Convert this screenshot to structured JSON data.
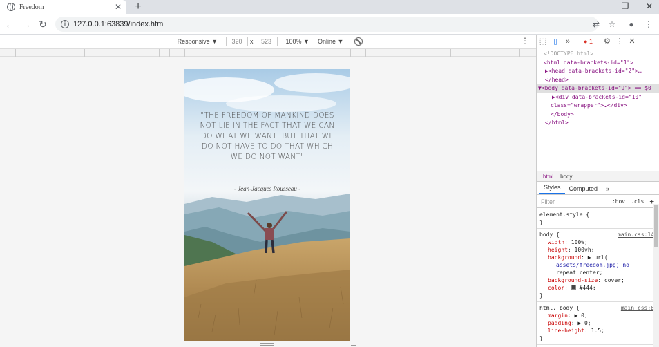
{
  "browser": {
    "tab_title": "Freedom",
    "tab_close": "✕",
    "new_tab": "+",
    "url": "127.0.0.1:63839/index.html"
  },
  "device_toolbar": {
    "mode": "Responsive ▼",
    "width": "320",
    "x_sep": "x",
    "height": "523",
    "zoom": "100% ▼",
    "network": "Online ▼",
    "more": "⋮"
  },
  "page": {
    "quote": "\"The freedom of mankind does not lie in the fact that we can do what we want, but that we do not have to do that which we do not want\"",
    "author": "- Jean-Jacques Rousseau -"
  },
  "devtools": {
    "top": {
      "more_tabs": "»",
      "errors": "1",
      "settings": "⚙",
      "menu": "⋮",
      "close": "✕"
    },
    "dom": {
      "doctype": "<!DOCTYPE html>",
      "html_open": "<html data-brackets-id=\"1\">",
      "head": "▶<head data-brackets-id=\"2\">…",
      "head_close": "</head>",
      "body_open": "▼<body data-brackets-id=\"9\"> == $0",
      "div_line1": "▶<div data-brackets-id=\"10\"",
      "div_line2": "class=\"wrapper\">…</div>",
      "body_close": "</body>",
      "html_close": "</html>"
    },
    "breadcrumb": {
      "html": "html",
      "body": "body"
    },
    "subtabs": {
      "styles": "Styles",
      "computed": "Computed",
      "more": "»"
    },
    "filter": {
      "placeholder": "Filter",
      "hov": ":hov",
      "cls": ".cls",
      "add": "+"
    },
    "styles": {
      "element_style": "element.style {",
      "brace_close": "}",
      "body_selector": "body {",
      "body_src": "main.css:14",
      "body_props": [
        {
          "name": "width",
          "value": "100%;"
        },
        {
          "name": "height",
          "value": "100vh;"
        },
        {
          "name": "background",
          "value": "url("
        },
        {
          "name": "",
          "value": "assets/freedom.jpg) no"
        },
        {
          "name": "",
          "value": "repeat center;"
        },
        {
          "name": "background-size",
          "value": "cover;"
        },
        {
          "name": "color",
          "value": "#444;"
        }
      ],
      "htmlbody_selector": "html, body {",
      "htmlbody_src": "main.css:8",
      "htmlbody_props": [
        {
          "name": "margin",
          "value": "▶ 0;"
        },
        {
          "name": "padding",
          "value": "▶ 0;"
        },
        {
          "name": "line-height",
          "value": "1.5;"
        }
      ]
    }
  },
  "colors": {
    "accent": "#1a73e8",
    "error": "#d93025",
    "tag": "#881280",
    "sky": "#a9cbe6",
    "grass": "#b08a52"
  }
}
